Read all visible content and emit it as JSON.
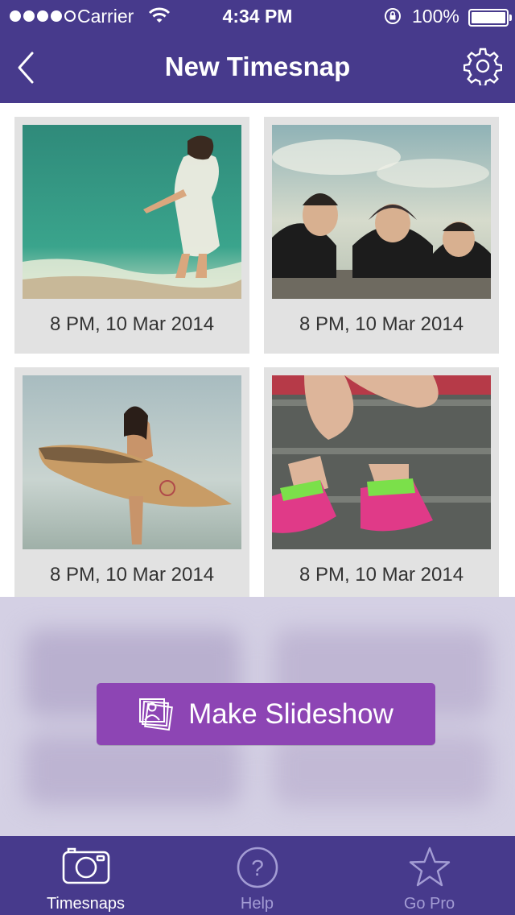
{
  "status_bar": {
    "carrier": "Carrier",
    "time": "4:34 PM",
    "battery": "100%",
    "signal_dots_filled": 4,
    "signal_dots_total": 5
  },
  "nav": {
    "title": "New Timesnap",
    "back_icon": "chevron-left-icon",
    "settings_icon": "gear-icon"
  },
  "cards": [
    {
      "caption": "8 PM, 10 Mar 2014",
      "photo": "woman-running-into-sea"
    },
    {
      "caption": "8 PM, 10 Mar 2014",
      "photo": "three-men-with-mustaches"
    },
    {
      "caption": "8 PM, 10 Mar 2014",
      "photo": "woman-holding-surfboard"
    },
    {
      "caption": "8 PM, 10 Mar 2014",
      "photo": "legs-pink-sneakers-on-steps"
    }
  ],
  "action": {
    "label": "Make Slideshow",
    "icon": "slideshow-photos-icon"
  },
  "tabs": [
    {
      "label": "Timesnaps",
      "icon": "camera-icon",
      "active": true
    },
    {
      "label": "Help",
      "icon": "help-circle-icon",
      "active": false
    },
    {
      "label": "Go Pro",
      "icon": "star-icon",
      "active": false
    }
  ],
  "colors": {
    "brand_purple": "#473a8c",
    "button_purple": "#8d45b4",
    "inactive_tab": "#a39cd4"
  }
}
